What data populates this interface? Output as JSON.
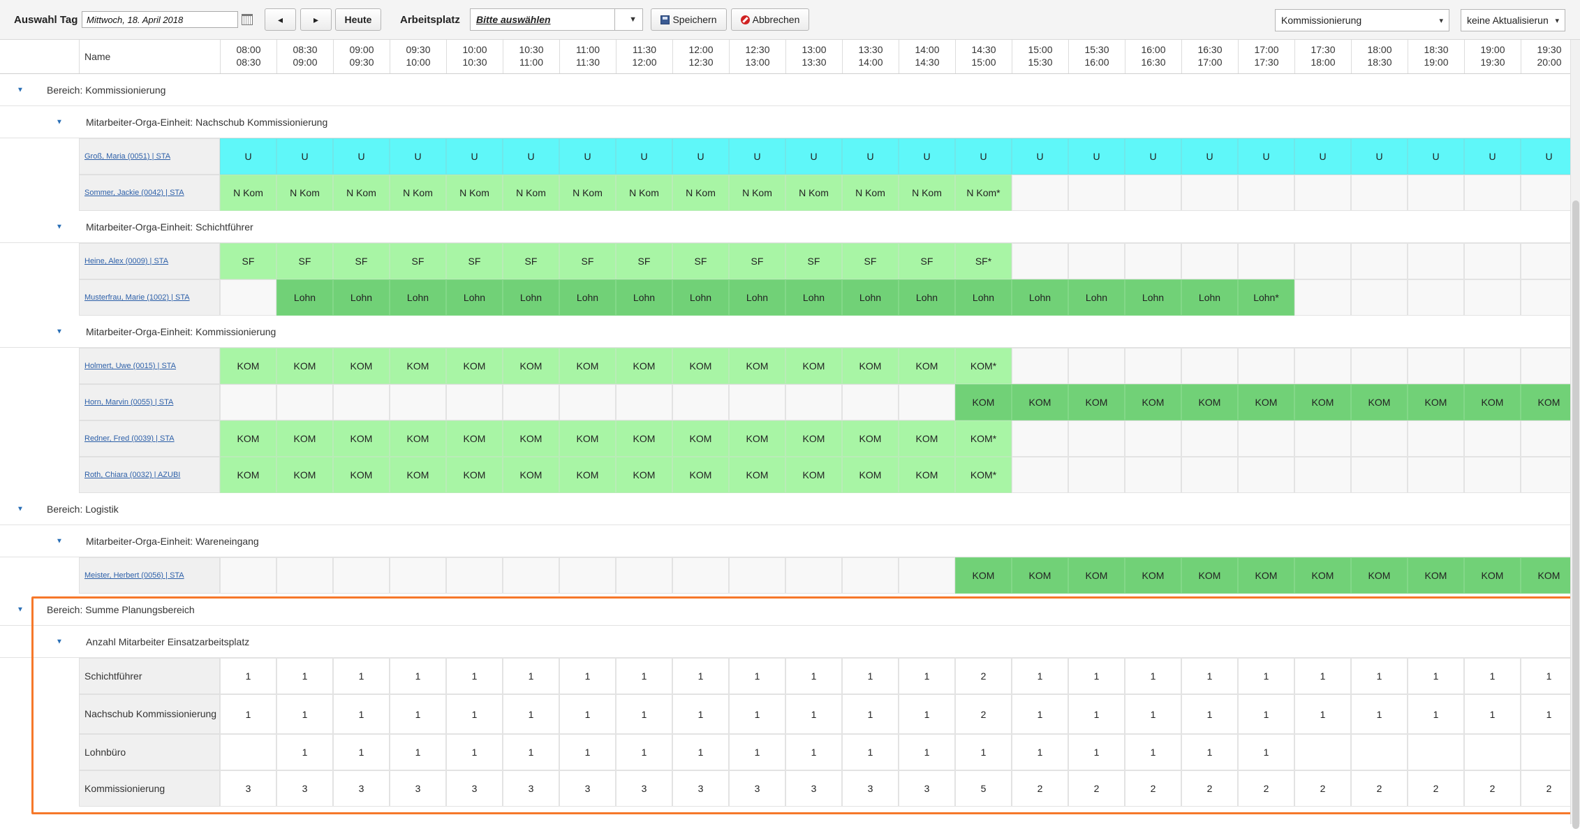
{
  "toolbar": {
    "day_label": "Auswahl Tag",
    "date_value": "Mittwoch, 18. April 2018",
    "today_label": "Heute",
    "workplace_label": "Arbeitsplatz",
    "workplace_value": "Bitte auswählen",
    "save_label": "Speichern",
    "cancel_label": "Abbrechen",
    "area_select_value": "Kommissionierung",
    "refresh_select_value": "keine Aktualisierun"
  },
  "table": {
    "name_header": "Name",
    "time_slots": [
      {
        "start": "08:00",
        "end": "08:30"
      },
      {
        "start": "08:30",
        "end": "09:00"
      },
      {
        "start": "09:00",
        "end": "09:30"
      },
      {
        "start": "09:30",
        "end": "10:00"
      },
      {
        "start": "10:00",
        "end": "10:30"
      },
      {
        "start": "10:30",
        "end": "11:00"
      },
      {
        "start": "11:00",
        "end": "11:30"
      },
      {
        "start": "11:30",
        "end": "12:00"
      },
      {
        "start": "12:00",
        "end": "12:30"
      },
      {
        "start": "12:30",
        "end": "13:00"
      },
      {
        "start": "13:00",
        "end": "13:30"
      },
      {
        "start": "13:30",
        "end": "14:00"
      },
      {
        "start": "14:00",
        "end": "14:30"
      },
      {
        "start": "14:30",
        "end": "15:00"
      },
      {
        "start": "15:00",
        "end": "15:30"
      },
      {
        "start": "15:30",
        "end": "16:00"
      },
      {
        "start": "16:00",
        "end": "16:30"
      },
      {
        "start": "16:30",
        "end": "17:00"
      },
      {
        "start": "17:00",
        "end": "17:30"
      },
      {
        "start": "17:30",
        "end": "18:00"
      },
      {
        "start": "18:00",
        "end": "18:30"
      },
      {
        "start": "18:30",
        "end": "19:00"
      },
      {
        "start": "19:00",
        "end": "19:30"
      },
      {
        "start": "19:30",
        "end": "20:00"
      }
    ],
    "sections": [
      {
        "label": "Bereich: Kommissionierung",
        "units": [
          {
            "label": "Mitarbeiter-Orga-Einheit: Nachschub Kommissionierung",
            "employees": [
              {
                "name": "Groß, Maria (0051) | STA",
                "cells": [
                  "U",
                  "U",
                  "U",
                  "U",
                  "U",
                  "U",
                  "U",
                  "U",
                  "U",
                  "U",
                  "U",
                  "U",
                  "U",
                  "U",
                  "U",
                  "U",
                  "U",
                  "U",
                  "U",
                  "U",
                  "U",
                  "U",
                  "U",
                  "U"
                ],
                "kind": [
                  "U",
                  "U",
                  "U",
                  "U",
                  "U",
                  "U",
                  "U",
                  "U",
                  "U",
                  "U",
                  "U",
                  "U",
                  "U",
                  "U",
                  "U",
                  "U",
                  "U",
                  "U",
                  "U",
                  "U",
                  "U",
                  "U",
                  "U",
                  "U"
                ]
              },
              {
                "name": "Sommer, Jackie (0042) | STA",
                "cells": [
                  "N Kom",
                  "N Kom",
                  "N Kom",
                  "N Kom",
                  "N Kom",
                  "N Kom",
                  "N Kom",
                  "N Kom",
                  "N Kom",
                  "N Kom",
                  "N Kom",
                  "N Kom",
                  "N Kom",
                  "N Kom*",
                  "",
                  "",
                  "",
                  "",
                  "",
                  "",
                  "",
                  "",
                  "",
                  ""
                ],
                "kind": [
                  "NKom",
                  "NKom",
                  "NKom",
                  "NKom",
                  "NKom",
                  "NKom",
                  "NKom",
                  "NKom",
                  "NKom",
                  "NKom",
                  "NKom",
                  "NKom",
                  "NKom",
                  "NKom",
                  "",
                  "",
                  "",
                  "",
                  "",
                  "",
                  "",
                  "",
                  "",
                  ""
                ]
              }
            ]
          },
          {
            "label": "Mitarbeiter-Orga-Einheit: Schichtführer",
            "employees": [
              {
                "name": "Heine, Alex (0009) | STA",
                "cells": [
                  "SF",
                  "SF",
                  "SF",
                  "SF",
                  "SF",
                  "SF",
                  "SF",
                  "SF",
                  "SF",
                  "SF",
                  "SF",
                  "SF",
                  "SF",
                  "SF*",
                  "",
                  "",
                  "",
                  "",
                  "",
                  "",
                  "",
                  "",
                  "",
                  ""
                ],
                "kind": [
                  "SF",
                  "SF",
                  "SF",
                  "SF",
                  "SF",
                  "SF",
                  "SF",
                  "SF",
                  "SF",
                  "SF",
                  "SF",
                  "SF",
                  "SF",
                  "SF",
                  "",
                  "",
                  "",
                  "",
                  "",
                  "",
                  "",
                  "",
                  "",
                  ""
                ]
              },
              {
                "name": "Musterfrau, Marie (1002) | STA",
                "cells": [
                  "",
                  "Lohn",
                  "Lohn",
                  "Lohn",
                  "Lohn",
                  "Lohn",
                  "Lohn",
                  "Lohn",
                  "Lohn",
                  "Lohn",
                  "Lohn",
                  "Lohn",
                  "Lohn",
                  "Lohn",
                  "Lohn",
                  "Lohn",
                  "Lohn",
                  "Lohn",
                  "Lohn*",
                  "",
                  "",
                  "",
                  "",
                  ""
                ],
                "kind": [
                  "",
                  "Lohn",
                  "Lohn",
                  "Lohn",
                  "Lohn",
                  "Lohn",
                  "Lohn",
                  "Lohn",
                  "Lohn",
                  "Lohn",
                  "Lohn",
                  "Lohn",
                  "Lohn",
                  "Lohn",
                  "Lohn",
                  "Lohn",
                  "Lohn",
                  "Lohn",
                  "Lohn",
                  "",
                  "",
                  "",
                  "",
                  ""
                ]
              }
            ]
          },
          {
            "label": "Mitarbeiter-Orga-Einheit: Kommissionierung",
            "employees": [
              {
                "name": "Holmert, Uwe (0015) | STA",
                "cells": [
                  "KOM",
                  "KOM",
                  "KOM",
                  "KOM",
                  "KOM",
                  "KOM",
                  "KOM",
                  "KOM",
                  "KOM",
                  "KOM",
                  "KOM",
                  "KOM",
                  "KOM",
                  "KOM*",
                  "",
                  "",
                  "",
                  "",
                  "",
                  "",
                  "",
                  "",
                  "",
                  ""
                ],
                "kind": [
                  "KOMlight",
                  "KOMlight",
                  "KOMlight",
                  "KOMlight",
                  "KOMlight",
                  "KOMlight",
                  "KOMlight",
                  "KOMlight",
                  "KOMlight",
                  "KOMlight",
                  "KOMlight",
                  "KOMlight",
                  "KOMlight",
                  "KOMlight",
                  "",
                  "",
                  "",
                  "",
                  "",
                  "",
                  "",
                  "",
                  "",
                  ""
                ]
              },
              {
                "name": "Horn, Marvin (0055) | STA",
                "cells": [
                  "",
                  "",
                  "",
                  "",
                  "",
                  "",
                  "",
                  "",
                  "",
                  "",
                  "",
                  "",
                  "",
                  "KOM",
                  "KOM",
                  "KOM",
                  "KOM",
                  "KOM",
                  "KOM",
                  "KOM",
                  "KOM",
                  "KOM",
                  "KOM",
                  "KOM"
                ],
                "kind": [
                  "",
                  "",
                  "",
                  "",
                  "",
                  "",
                  "",
                  "",
                  "",
                  "",
                  "",
                  "",
                  "",
                  "KOMdark",
                  "KOMdark",
                  "KOMdark",
                  "KOMdark",
                  "KOMdark",
                  "KOMdark",
                  "KOMdark",
                  "KOMdark",
                  "KOMdark",
                  "KOMdark",
                  "KOMdark"
                ]
              },
              {
                "name": "Redner, Fred (0039) | STA",
                "cells": [
                  "KOM",
                  "KOM",
                  "KOM",
                  "KOM",
                  "KOM",
                  "KOM",
                  "KOM",
                  "KOM",
                  "KOM",
                  "KOM",
                  "KOM",
                  "KOM",
                  "KOM",
                  "KOM*",
                  "",
                  "",
                  "",
                  "",
                  "",
                  "",
                  "",
                  "",
                  "",
                  ""
                ],
                "kind": [
                  "KOMlight",
                  "KOMlight",
                  "KOMlight",
                  "KOMlight",
                  "KOMlight",
                  "KOMlight",
                  "KOMlight",
                  "KOMlight",
                  "KOMlight",
                  "KOMlight",
                  "KOMlight",
                  "KOMlight",
                  "KOMlight",
                  "KOMlight",
                  "",
                  "",
                  "",
                  "",
                  "",
                  "",
                  "",
                  "",
                  "",
                  ""
                ]
              },
              {
                "name": "Roth, Chiara (0032) | AZUBI",
                "cells": [
                  "KOM",
                  "KOM",
                  "KOM",
                  "KOM",
                  "KOM",
                  "KOM",
                  "KOM",
                  "KOM",
                  "KOM",
                  "KOM",
                  "KOM",
                  "KOM",
                  "KOM",
                  "KOM*",
                  "",
                  "",
                  "",
                  "",
                  "",
                  "",
                  "",
                  "",
                  "",
                  ""
                ],
                "kind": [
                  "KOMlight",
                  "KOMlight",
                  "KOMlight",
                  "KOMlight",
                  "KOMlight",
                  "KOMlight",
                  "KOMlight",
                  "KOMlight",
                  "KOMlight",
                  "KOMlight",
                  "KOMlight",
                  "KOMlight",
                  "KOMlight",
                  "KOMlight",
                  "",
                  "",
                  "",
                  "",
                  "",
                  "",
                  "",
                  "",
                  "",
                  ""
                ]
              }
            ]
          }
        ]
      },
      {
        "label": "Bereich: Logistik",
        "units": [
          {
            "label": "Mitarbeiter-Orga-Einheit: Wareneingang",
            "employees": [
              {
                "name": "Meister, Herbert (0056) | STA",
                "cells": [
                  "",
                  "",
                  "",
                  "",
                  "",
                  "",
                  "",
                  "",
                  "",
                  "",
                  "",
                  "",
                  "",
                  "KOM",
                  "KOM",
                  "KOM",
                  "KOM",
                  "KOM",
                  "KOM",
                  "KOM",
                  "KOM",
                  "KOM",
                  "KOM",
                  "KOM"
                ],
                "kind": [
                  "",
                  "",
                  "",
                  "",
                  "",
                  "",
                  "",
                  "",
                  "",
                  "",
                  "",
                  "",
                  "",
                  "KOMdark",
                  "KOMdark",
                  "KOMdark",
                  "KOMdark",
                  "KOMdark",
                  "KOMdark",
                  "KOMdark",
                  "KOMdark",
                  "KOMdark",
                  "KOMdark",
                  "KOMdark"
                ]
              }
            ]
          }
        ]
      }
    ],
    "summary": {
      "label": "Bereich: Summe Planungsbereich",
      "unit_label": "Anzahl Mitarbeiter Einsatzarbeitsplatz",
      "rows": [
        {
          "name": "Schichtführer",
          "cells": [
            "1",
            "1",
            "1",
            "1",
            "1",
            "1",
            "1",
            "1",
            "1",
            "1",
            "1",
            "1",
            "1",
            "2",
            "1",
            "1",
            "1",
            "1",
            "1",
            "1",
            "1",
            "1",
            "1",
            "1"
          ]
        },
        {
          "name": "Nachschub Kommissionierung",
          "cells": [
            "1",
            "1",
            "1",
            "1",
            "1",
            "1",
            "1",
            "1",
            "1",
            "1",
            "1",
            "1",
            "1",
            "2",
            "1",
            "1",
            "1",
            "1",
            "1",
            "1",
            "1",
            "1",
            "1",
            "1"
          ]
        },
        {
          "name": "Lohnbüro",
          "cells": [
            "",
            "1",
            "1",
            "1",
            "1",
            "1",
            "1",
            "1",
            "1",
            "1",
            "1",
            "1",
            "1",
            "1",
            "1",
            "1",
            "1",
            "1",
            "1",
            "",
            "",
            "",
            "",
            ""
          ]
        },
        {
          "name": "Kommissionierung",
          "cells": [
            "3",
            "3",
            "3",
            "3",
            "3",
            "3",
            "3",
            "3",
            "3",
            "3",
            "3",
            "3",
            "3",
            "5",
            "2",
            "2",
            "2",
            "2",
            "2",
            "2",
            "2",
            "2",
            "2",
            "2"
          ]
        }
      ]
    }
  }
}
